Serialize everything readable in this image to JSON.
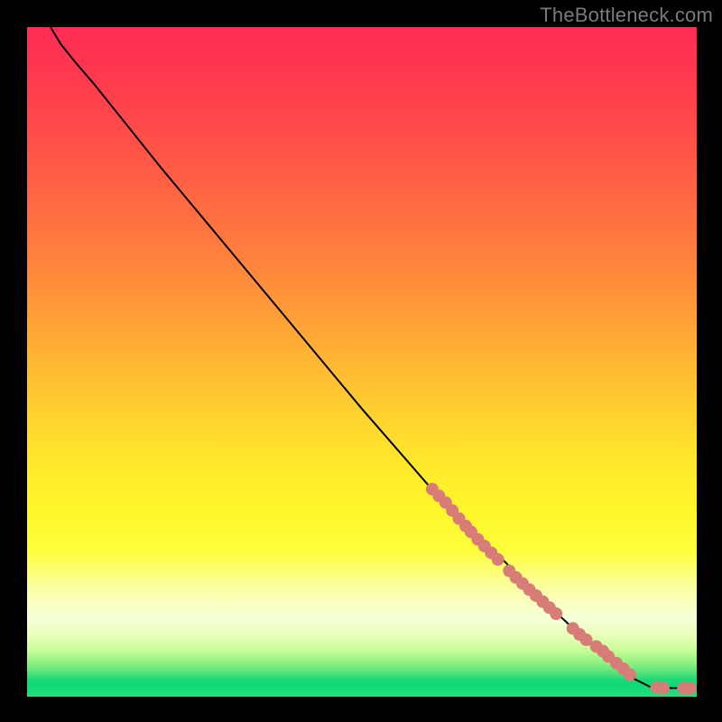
{
  "attribution": "TheBottleneck.com",
  "chart_data": {
    "type": "line",
    "title": "",
    "xlabel": "",
    "ylabel": "",
    "xlim": [
      0,
      100
    ],
    "ylim": [
      0,
      100
    ],
    "series": [
      {
        "name": "curve",
        "color": "#000000",
        "points": [
          {
            "x": 3.5,
            "y": 100
          },
          {
            "x": 5.0,
            "y": 97.5
          },
          {
            "x": 7.0,
            "y": 95.0
          },
          {
            "x": 10.0,
            "y": 91.5
          },
          {
            "x": 20.0,
            "y": 79.0
          },
          {
            "x": 30.0,
            "y": 67.0
          },
          {
            "x": 40.0,
            "y": 55.0
          },
          {
            "x": 50.0,
            "y": 43.0
          },
          {
            "x": 60.0,
            "y": 31.5
          },
          {
            "x": 70.0,
            "y": 21.5
          },
          {
            "x": 78.0,
            "y": 13.5
          },
          {
            "x": 85.0,
            "y": 7.0
          },
          {
            "x": 90.0,
            "y": 3.0
          },
          {
            "x": 93.0,
            "y": 1.5
          },
          {
            "x": 96.0,
            "y": 1.3
          },
          {
            "x": 99.0,
            "y": 1.3
          }
        ]
      }
    ],
    "markers": {
      "color": "#d87c77",
      "radius": 7,
      "points": [
        {
          "x": 60.5,
          "y": 31.0
        },
        {
          "x": 61.5,
          "y": 30.0
        },
        {
          "x": 62.5,
          "y": 29.0
        },
        {
          "x": 63.5,
          "y": 27.8
        },
        {
          "x": 64.5,
          "y": 26.6
        },
        {
          "x": 65.5,
          "y": 25.5
        },
        {
          "x": 66.3,
          "y": 24.6
        },
        {
          "x": 67.3,
          "y": 23.5
        },
        {
          "x": 68.3,
          "y": 22.5
        },
        {
          "x": 69.3,
          "y": 21.5
        },
        {
          "x": 70.3,
          "y": 20.5
        },
        {
          "x": 72.0,
          "y": 18.8
        },
        {
          "x": 73.0,
          "y": 17.8
        },
        {
          "x": 74.0,
          "y": 16.9
        },
        {
          "x": 75.0,
          "y": 16.0
        },
        {
          "x": 76.0,
          "y": 15.1
        },
        {
          "x": 77.0,
          "y": 14.2
        },
        {
          "x": 78.0,
          "y": 13.3
        },
        {
          "x": 79.0,
          "y": 12.4
        },
        {
          "x": 81.5,
          "y": 10.2
        },
        {
          "x": 82.5,
          "y": 9.3
        },
        {
          "x": 83.5,
          "y": 8.5
        },
        {
          "x": 85.0,
          "y": 7.5
        },
        {
          "x": 86.0,
          "y": 6.8
        },
        {
          "x": 86.8,
          "y": 6.0
        },
        {
          "x": 88.0,
          "y": 5.0
        },
        {
          "x": 89.0,
          "y": 4.2
        },
        {
          "x": 90.0,
          "y": 3.3
        },
        {
          "x": 94.0,
          "y": 1.4
        },
        {
          "x": 95.0,
          "y": 1.3
        },
        {
          "x": 98.0,
          "y": 1.3
        },
        {
          "x": 99.0,
          "y": 1.3
        }
      ]
    }
  }
}
